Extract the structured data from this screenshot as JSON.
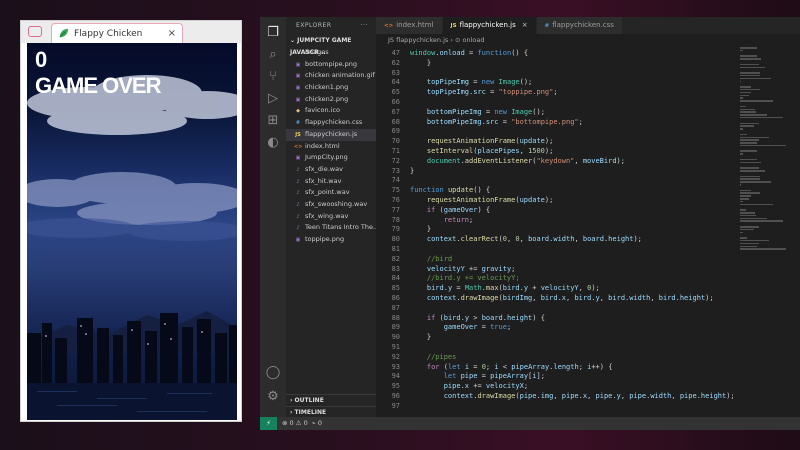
{
  "browser": {
    "tab_title": "Flappy Chicken",
    "close_glyph": "×",
    "favicon": "leaf-icon"
  },
  "game": {
    "score": "0",
    "game_over_text": "GAME OVER"
  },
  "editor": {
    "explorer_label": "EXPLORER",
    "more_glyph": "···",
    "project_label": "⌄ JUMPCITY GAME JAVASCR...",
    "files": [
      {
        "name": "images",
        "type": "folder",
        "badge": "›"
      },
      {
        "name": "bottompipe.png",
        "type": "image",
        "badge": "▣"
      },
      {
        "name": "chicken animation.gif",
        "type": "image",
        "badge": "▣"
      },
      {
        "name": "chicken1.png",
        "type": "image",
        "badge": "▣"
      },
      {
        "name": "chicken2.png",
        "type": "image",
        "badge": "▣"
      },
      {
        "name": "favicon.ico",
        "type": "ico",
        "badge": "◆"
      },
      {
        "name": "flappychicken.css",
        "type": "css",
        "badge": "#"
      },
      {
        "name": "flappychicken.js",
        "type": "js",
        "badge": "JS"
      },
      {
        "name": "index.html",
        "type": "html",
        "badge": "<>"
      },
      {
        "name": "JumpCity.png",
        "type": "image",
        "badge": "▣"
      },
      {
        "name": "sfx_die.wav",
        "type": "audio",
        "badge": "♪"
      },
      {
        "name": "sfx_hit.wav",
        "type": "audio",
        "badge": "♪"
      },
      {
        "name": "sfx_point.wav",
        "type": "audio",
        "badge": "♪"
      },
      {
        "name": "sfx_swooshing.wav",
        "type": "audio",
        "badge": "♪"
      },
      {
        "name": "sfx_wing.wav",
        "type": "audio",
        "badge": "♪"
      },
      {
        "name": "Teen Titans Intro The...",
        "type": "audio",
        "badge": "♪"
      },
      {
        "name": "toppipe.png",
        "type": "image",
        "badge": "▣"
      }
    ],
    "outline_label": "› OUTLINE",
    "timeline_label": "› TIMELINE",
    "tabs": [
      {
        "name": "index.html",
        "badge": "<>",
        "active": false
      },
      {
        "name": "flappychicken.js",
        "badge": "JS",
        "active": true
      },
      {
        "name": "flappychicken.css",
        "badge": "#",
        "active": false
      }
    ],
    "tab_close_glyph": "×",
    "breadcrumbs": "JS flappychicken.js › ⊙ onload",
    "status": {
      "remote_glyph": "⚡",
      "problems": "⊗ 0 ⚠ 0",
      "ports": "⌁ 0"
    },
    "code_lines": [
      {
        "n": "47",
        "t": "window.onload = function() {"
      },
      {
        "n": "62",
        "t": "    }"
      },
      {
        "n": "63",
        "t": ""
      },
      {
        "n": "64",
        "t": "    topPipeImg = new Image();"
      },
      {
        "n": "65",
        "t": "    topPipeImg.src = \"toppipe.png\";"
      },
      {
        "n": "66",
        "t": ""
      },
      {
        "n": "67",
        "t": "    bottomPipeImg = new Image();"
      },
      {
        "n": "68",
        "t": "    bottomPipeImg.src = \"bottompipe.png\";"
      },
      {
        "n": "69",
        "t": ""
      },
      {
        "n": "70",
        "t": "    requestAnimationFrame(update);"
      },
      {
        "n": "71",
        "t": "    setInterval(placePipes, 1500);"
      },
      {
        "n": "72",
        "t": "    document.addEventListener(\"keydown\", moveBird);"
      },
      {
        "n": "73",
        "t": "}"
      },
      {
        "n": "74",
        "t": ""
      },
      {
        "n": "75",
        "t": "function update() {"
      },
      {
        "n": "76",
        "t": "    requestAnimationFrame(update);"
      },
      {
        "n": "77",
        "t": "    if (gameOver) {"
      },
      {
        "n": "78",
        "t": "        return;"
      },
      {
        "n": "79",
        "t": "    }"
      },
      {
        "n": "80",
        "t": "    context.clearRect(0, 0, board.width, board.height);"
      },
      {
        "n": "81",
        "t": ""
      },
      {
        "n": "82",
        "t": "    //bird"
      },
      {
        "n": "83",
        "t": "    velocityY += gravity;"
      },
      {
        "n": "84",
        "t": "    //bird.y += velocityY;"
      },
      {
        "n": "85",
        "t": "    bird.y = Math.max(bird.y + velocityY, 0);"
      },
      {
        "n": "86",
        "t": "    context.drawImage(birdImg, bird.x, bird.y, bird.width, bird.height);"
      },
      {
        "n": "87",
        "t": ""
      },
      {
        "n": "88",
        "t": "    if (bird.y > board.height) {"
      },
      {
        "n": "89",
        "t": "        gameOver = true;"
      },
      {
        "n": "90",
        "t": "    }"
      },
      {
        "n": "91",
        "t": ""
      },
      {
        "n": "92",
        "t": "    //pipes"
      },
      {
        "n": "93",
        "t": "    for (let i = 0; i < pipeArray.length; i++) {"
      },
      {
        "n": "94",
        "t": "        let pipe = pipeArray[i];"
      },
      {
        "n": "95",
        "t": "        pipe.x += velocityX;"
      },
      {
        "n": "96",
        "t": "        context.drawImage(pipe.img, pipe.x, pipe.y, pipe.width, pipe.height);"
      },
      {
        "n": "97",
        "t": ""
      }
    ]
  },
  "colors": {
    "accent_tab_border": "#e9a7b8",
    "status_remote": "#16825d",
    "editor_bg": "#1e1e1e"
  }
}
